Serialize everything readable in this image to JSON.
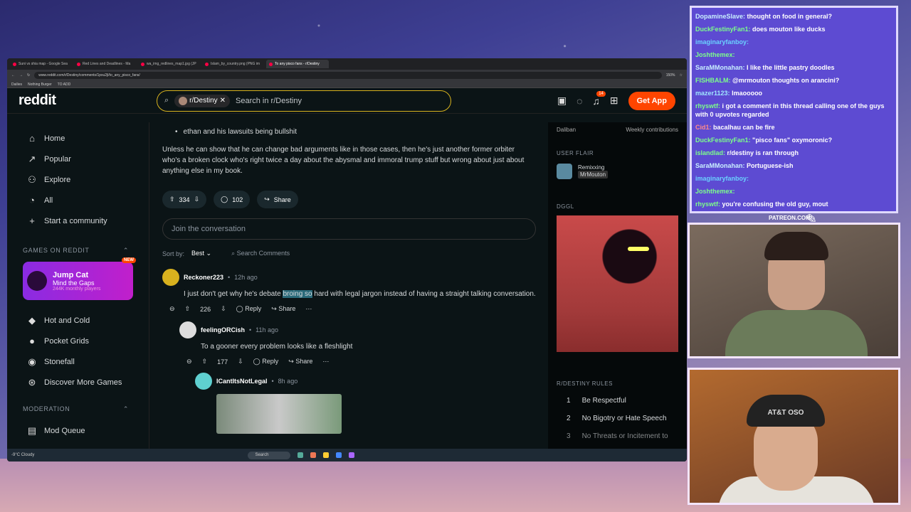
{
  "browser": {
    "tabs": [
      "Suni vs shia map - Google Sea",
      "Red Lines and Deadlines - Ma",
      "wa_img_redlines_map1.jpg (JP",
      "Islam_by_country.png (PNG im",
      "To any pisco fans - r/Destiny"
    ],
    "url": "www.reddit.com/r/Destiny/comments/1pxu2jl/to_any_pisco_fans/",
    "zoom": "150%",
    "bookmarks": [
      "Dailies",
      "Nothing Burger",
      "TO ADD"
    ]
  },
  "header": {
    "logo": "reddit",
    "search_chip": "r/Destiny",
    "search_placeholder": "Search in r/Destiny",
    "notif_count": "14",
    "get_app": "Get App"
  },
  "sidebar": {
    "nav": [
      {
        "label": "Home",
        "icon": "⌂"
      },
      {
        "label": "Popular",
        "icon": "↗"
      },
      {
        "label": "Explore",
        "icon": "⚇"
      },
      {
        "label": "All",
        "icon": "◔"
      },
      {
        "label": "Start a community",
        "icon": "+"
      }
    ],
    "games_title": "GAMES ON REDDIT",
    "featured_game": {
      "name": "Jump Cat",
      "sub": "Mind the Gaps",
      "players": "244K monthly players",
      "badge": "NEW"
    },
    "games": [
      "Hot and Cold",
      "Pocket Grids",
      "Stonefall",
      "Discover More Games"
    ],
    "moderation_title": "MODERATION",
    "mod_queue": "Mod Queue"
  },
  "post": {
    "bullet": "ethan and his lawsuits being bullshit",
    "paragraph": "Unless he can show that he can change bad arguments like in those cases, then he's just another former orbiter who's a broken clock who's right twice a day about the abysmal and immoral trump stuff but wrong about just about anything else in my book.",
    "votes": "334",
    "comments": "102",
    "share": "Share",
    "join_placeholder": "Join the conversation",
    "sort_label": "Sort by:",
    "sort_value": "Best",
    "search_comments": "Search Comments"
  },
  "comments": [
    {
      "user": "Reckoner223",
      "time": "12h ago",
      "text_pre": "I just don't get why he's debate ",
      "text_hl": "broing so",
      "text_post": " hard with legal jargon instead of having a straight talking conversation.",
      "votes": "226",
      "reply": "Reply",
      "share": "Share"
    },
    {
      "user": "feelingORCish",
      "time": "11h ago",
      "text": "To a gooner every problem looks like a fleshlight",
      "votes": "177",
      "reply": "Reply",
      "share": "Share"
    },
    {
      "user": "ICantItsNotLegal",
      "time": "8h ago"
    }
  ],
  "right": {
    "col1": "Daliban",
    "col2": "Weekly contributions",
    "flair_title": "USER FLAIR",
    "flair_line1": "Remixxing",
    "flair_line2": "MrMouton",
    "dggl_title": "DGGL",
    "rules_title": "R/DESTINY RULES",
    "rules": [
      {
        "n": "1",
        "t": "Be Respectful"
      },
      {
        "n": "2",
        "t": "No Bigotry or Hate Speech"
      },
      {
        "n": "3",
        "t": "No Threats or Incitement to"
      }
    ]
  },
  "taskbar": {
    "weather_temp": "-9°C",
    "weather_desc": "Cloudy",
    "search": "Search"
  },
  "chat": [
    {
      "name": "DopamineSlave:",
      "text": "thought on food in general?",
      "c": ""
    },
    {
      "name": "DuckFestinyFan1:",
      "text": "does mouton like ducks",
      "c": "g"
    },
    {
      "name": "imaginaryfanboy:",
      "text": "",
      "c": "l"
    },
    {
      "name": "Joshthemex:",
      "text": "",
      "c": "g"
    },
    {
      "name": "SaraMMonahan:",
      "text": "I like the little pastry doodles",
      "c": ""
    },
    {
      "name": "FISHBALM:",
      "text": "@mrmouton thoughts on arancini?",
      "c": "g"
    },
    {
      "name": "mazer1123:",
      "text": "lmaooooo",
      "c": "o"
    },
    {
      "name": "rhyswtf:",
      "text": "i got a comment in this thread calling one of the guys with 0 upvotes regarded",
      "c": "g"
    },
    {
      "name": "Cid1:",
      "text": "bacalhau can be fire",
      "c": "r"
    },
    {
      "name": "DuckFestinyFan1:",
      "text": "\"pisco fans\" oxymoronic?",
      "c": "g"
    },
    {
      "name": "islandlad:",
      "text": "r/destiny is ran through",
      "c": "g"
    },
    {
      "name": "SaraMMonahan:",
      "text": "Portuguese-ish",
      "c": ""
    },
    {
      "name": "imaginaryfanboy:",
      "text": "",
      "c": "l"
    },
    {
      "name": "Joshthemex:",
      "text": "",
      "c": "g"
    },
    {
      "name": "rhyswtf:",
      "text": "you're confusing the old guy, mout",
      "c": "g"
    }
  ],
  "overlay": {
    "patreon": "PATREON.COM/",
    "cap_text": "AT&T OSO"
  }
}
